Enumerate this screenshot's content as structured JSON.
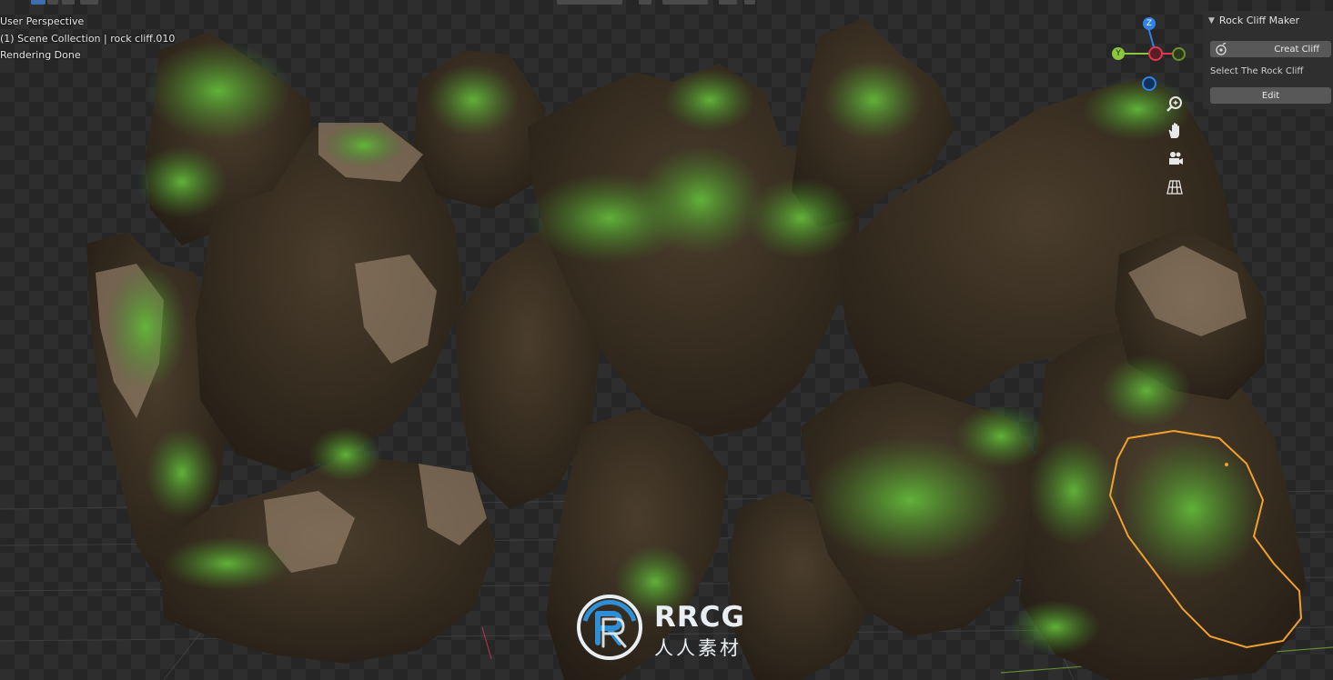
{
  "viewport": {
    "view_name": "User Perspective",
    "collection_line": "(1) Scene Collection | rock cliff.010",
    "status": "Rendering Done"
  },
  "gizmo": {
    "z_label": "Z",
    "y_label": "Y",
    "colors": {
      "x": "#e0384d",
      "y": "#8bc63f",
      "z": "#2f83e8"
    }
  },
  "nav_tools": [
    "zoom-icon",
    "hand-pan-icon",
    "camera-icon",
    "grid-ortho-icon"
  ],
  "panel": {
    "title": "Rock Cliff Maker",
    "create_label": "Creat Cliff",
    "select_label": "Select The Rock Cliff",
    "edit_label": "Edit"
  },
  "selection_outline_color": "#f0a030",
  "watermark": {
    "main": "RRCG",
    "sub": "人人素材"
  }
}
